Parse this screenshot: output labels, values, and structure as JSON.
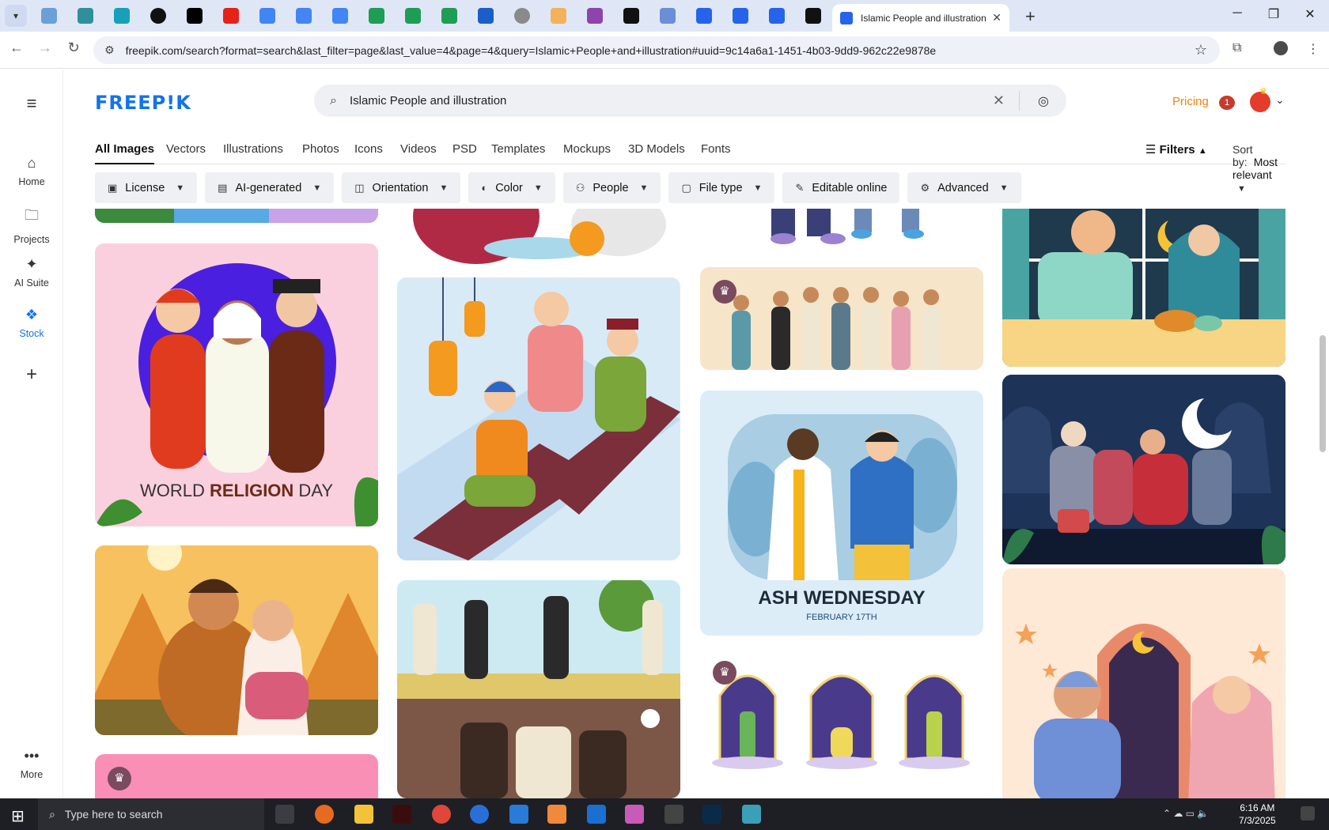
{
  "browser": {
    "active_tab_title": "Islamic People and illustration vectors",
    "url": "freepik.com/search?format=search&last_filter=page&last_value=4&page=4&query=Islamic+People+and+illustration#uuid=9c14a6a1-1451-4b03-9dd9-962c22e9878e"
  },
  "site": {
    "logo": "FREEP!K",
    "search_value": "Islamic People and illustration",
    "pricing": "Pricing",
    "notif_count": "1"
  },
  "sidebar": {
    "home": "Home",
    "projects": "Projects",
    "ai_suite": "AI Suite",
    "stock": "Stock",
    "more": "More"
  },
  "categories": [
    "All Images",
    "Vectors",
    "Illustrations",
    "Photos",
    "Icons",
    "Videos",
    "PSD",
    "Templates",
    "Mockups",
    "3D Models",
    "Fonts"
  ],
  "toolbar": {
    "filters": "Filters",
    "sort_label": "Sort by:",
    "sort_value": "Most relevant"
  },
  "filters": [
    "License",
    "AI-generated",
    "Orientation",
    "Color",
    "People",
    "File type",
    "Editable online",
    "Advanced"
  ],
  "cards": {
    "world_religion_a": "WORLD ",
    "world_religion_b": "RELIGION",
    "world_religion_c": " DAY",
    "ash_title": "ASH WEDNESDAY",
    "ash_date": "FEBRUARY 17TH"
  },
  "taskbar": {
    "search_placeholder": "Type here to search",
    "time": "6:16 AM",
    "date": "7/3/2025"
  }
}
